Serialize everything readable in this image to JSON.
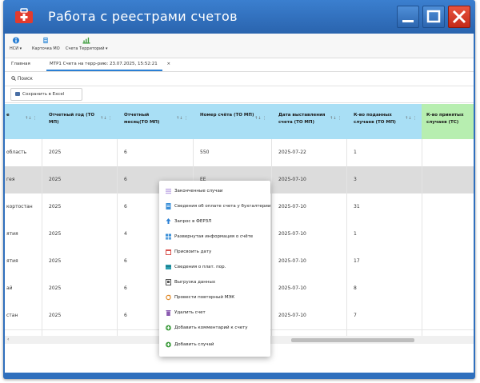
{
  "window": {
    "title": "Работа с реестрами счетов"
  },
  "toolbar": [
    {
      "label": "НСИ ▾",
      "icon": "info-icon",
      "color": "#2a7fd4"
    },
    {
      "label": "Карточка МО",
      "icon": "card-icon",
      "color": "#3a8fd8"
    },
    {
      "label": "Счета Территорий ▾",
      "icon": "chart-icon",
      "color": "#3a9a3a"
    }
  ],
  "tabs": [
    {
      "label": "Главная",
      "close": ""
    },
    {
      "label": "МТР1 Счета на терр-рию: 23.07.2025, 15:52:21",
      "close": "×"
    }
  ],
  "search": {
    "label": "Поиск"
  },
  "excel": {
    "label": "Сохранить в Excel"
  },
  "table": {
    "headers": [
      {
        "text": "е",
        "sort": "↑↓ ⋮"
      },
      {
        "text": "Отчетный год (ТО МП)",
        "sort": "↑↓ ⋮"
      },
      {
        "text": "Отчетный месяц(ТО МП)",
        "sort": "↑↓ ⋮"
      },
      {
        "text": "Номер счёта (ТО МП)",
        "sort": "↑↓ ⋮"
      },
      {
        "text": "Дата выставления счета (ТО МП)",
        "sort": "↑↓ ⋮"
      },
      {
        "text": "К-во поданных случаев (ТО МП)",
        "sort": "↑↓ ⋮"
      },
      {
        "text": "К-во принятых случаев (ТС)",
        "sort": ""
      }
    ],
    "rows": [
      [
        "область",
        "2025",
        "6",
        "550",
        "2025-07-22",
        "1",
        ""
      ],
      [
        "гея",
        "2025",
        "6",
        "ЕЕ",
        "2025-07-10",
        "3",
        ""
      ],
      [
        "кортостан",
        "2025",
        "6",
        "",
        "2025-07-10",
        "31",
        ""
      ],
      [
        "ятия",
        "2025",
        "4",
        "",
        "2025-07-10",
        "1",
        ""
      ],
      [
        "ятия",
        "2025",
        "6",
        "",
        "2025-07-10",
        "17",
        ""
      ],
      [
        "ай",
        "2025",
        "6",
        "",
        "2025-07-10",
        "8",
        ""
      ],
      [
        "стан",
        "2025",
        "6",
        "",
        "2025-07-10",
        "7",
        ""
      ]
    ]
  },
  "scroll": {
    "left_arrow": "‹"
  },
  "context_menu": [
    {
      "label": "Законченные случаи",
      "icon": "list-icon",
      "color": "#b59be0"
    },
    {
      "label": "Сведения об оплате счета у бухгалтерии",
      "icon": "doc-icon",
      "color": "#3a8fd8"
    },
    {
      "label": "Запрос в ФЕРЗЛ",
      "icon": "upload-icon",
      "color": "#2a7fd4"
    },
    {
      "label": "Развернутая информация о счёте",
      "icon": "table-icon",
      "color": "#3a8fd8"
    },
    {
      "label": "Присвоить дату",
      "icon": "calendar-icon",
      "color": "#d9534f"
    },
    {
      "label": "Сведения о плат. пор.",
      "icon": "card-icon",
      "color": "#2a9fb0"
    },
    {
      "label": "Выгрузка данных",
      "icon": "export-icon",
      "color": "#555555"
    },
    {
      "label": "Провести повторный МЭК",
      "icon": "refresh-icon",
      "color": "#e08a2a"
    },
    {
      "label": "Удалить счет",
      "icon": "trash-icon",
      "color": "#8a5ab0"
    },
    {
      "label": "Добавить комментарий к счету",
      "icon": "plus-circle-icon",
      "color": "#3a9a3a"
    },
    {
      "label": "Добавить случай",
      "icon": "plus-circle-icon",
      "color": "#3a9a3a"
    }
  ]
}
